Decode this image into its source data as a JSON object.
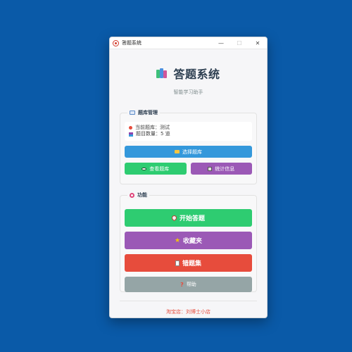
{
  "window": {
    "title": "答题系统",
    "minimize": "—",
    "maximize": "☐",
    "close": "✕"
  },
  "header": {
    "title": "答题系统",
    "subtitle": "智能学习助手"
  },
  "library": {
    "group_title": "题库管理",
    "current_label": "当前题库：测试",
    "count_label": "题目数量：5 道",
    "select_button": "选择题库",
    "view_button": "查看题库",
    "stats_button": "统计信息"
  },
  "functions": {
    "group_title": "功能",
    "start_button": "开始答题",
    "favorites_button": "收藏夹",
    "wrong_button": "错题集",
    "help_button": "帮助"
  },
  "footer": {
    "text": "淘宝店：刘博士小店"
  },
  "colors": {
    "desktop": "#0a5aa8",
    "blue": "#3498db",
    "green": "#2ecc71",
    "purple": "#9b59b6",
    "red": "#e74c3c",
    "gray": "#95a5a6"
  }
}
